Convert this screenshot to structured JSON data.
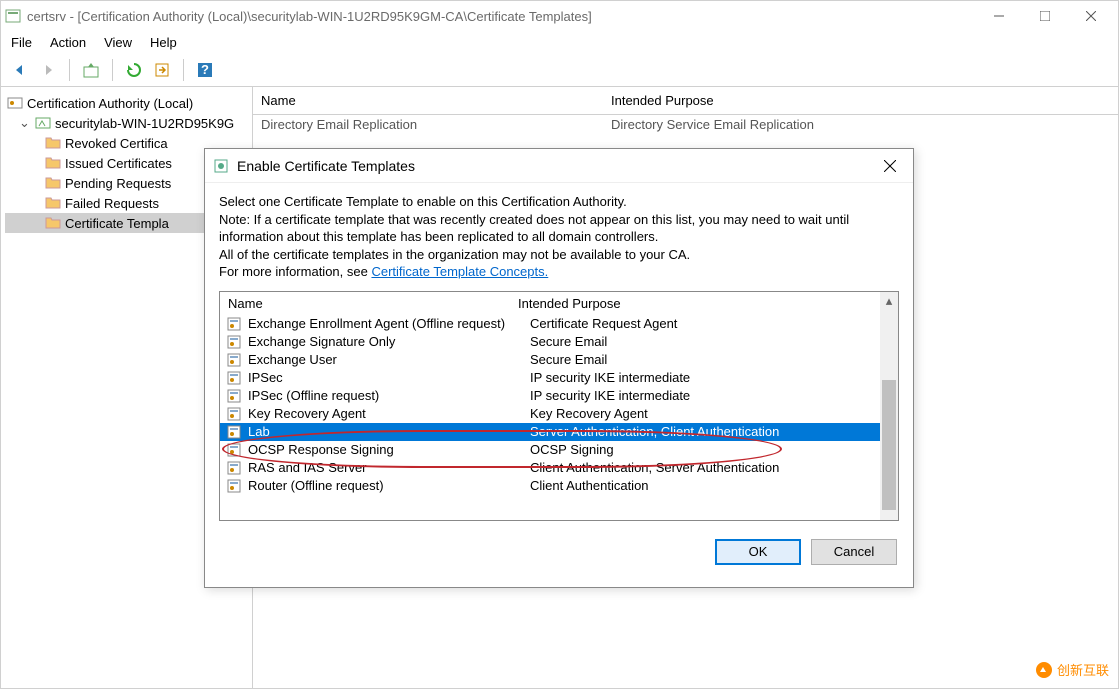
{
  "window": {
    "title": "certsrv - [Certification Authority (Local)\\securitylab-WIN-1U2RD95K9GM-CA\\Certificate Templates]"
  },
  "menubar": {
    "file": "File",
    "action": "Action",
    "view": "View",
    "help": "Help"
  },
  "tree": {
    "root": "Certification Authority (Local)",
    "ca": "securitylab-WIN-1U2RD95K9G",
    "items": [
      "Revoked Certifica",
      "Issued Certificates",
      "Pending Requests",
      "Failed Requests",
      "Certificate Templa"
    ]
  },
  "list": {
    "header_name": "Name",
    "header_purpose": "Intended Purpose",
    "row0_name": "Directory Email Replication",
    "row0_purpose": "Directory Service Email Replication"
  },
  "dialog": {
    "title": "Enable Certificate Templates",
    "intro1": "Select one Certificate Template to enable on this Certification Authority.",
    "intro2": "Note: If a certificate template that was recently created does not appear on this list, you may need to wait until information about this template has been replicated to all domain controllers.",
    "intro3": "All of the certificate templates in the organization may not be available to your CA.",
    "link_prefix": "For more information, see ",
    "link_text": "Certificate Template Concepts.",
    "header_name": "Name",
    "header_purpose": "Intended Purpose",
    "rows": [
      {
        "name": "Exchange Enrollment Agent (Offline request)",
        "purpose": "Certificate Request Agent"
      },
      {
        "name": "Exchange Signature Only",
        "purpose": "Secure Email"
      },
      {
        "name": "Exchange User",
        "purpose": "Secure Email"
      },
      {
        "name": "IPSec",
        "purpose": "IP security IKE intermediate"
      },
      {
        "name": "IPSec (Offline request)",
        "purpose": "IP security IKE intermediate"
      },
      {
        "name": "Key Recovery Agent",
        "purpose": "Key Recovery Agent"
      },
      {
        "name": "Lab",
        "purpose": "Server Authentication, Client Authentication"
      },
      {
        "name": "OCSP Response Signing",
        "purpose": "OCSP Signing"
      },
      {
        "name": "RAS and IAS Server",
        "purpose": "Client Authentication, Server Authentication"
      },
      {
        "name": "Router (Offline request)",
        "purpose": "Client Authentication"
      }
    ],
    "ok": "OK",
    "cancel": "Cancel"
  },
  "watermark": "创新互联"
}
